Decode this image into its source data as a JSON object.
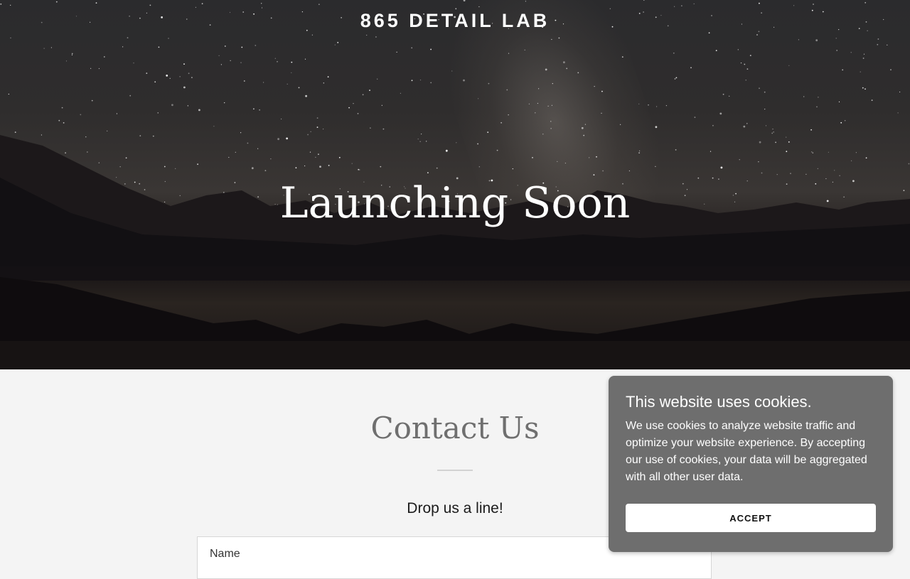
{
  "header": {
    "brand": "865 DETAIL LAB"
  },
  "hero": {
    "title": "Launching Soon"
  },
  "contact": {
    "title": "Contact Us",
    "subtitle": "Drop us a line!",
    "name_placeholder": "Name"
  },
  "cookie_banner": {
    "title": "This website uses cookies.",
    "text": "We use cookies to analyze website traffic and optimize your website experience. By accepting our use of cookies, your data will be aggregated with all other user data.",
    "accept_label": "ACCEPT"
  }
}
